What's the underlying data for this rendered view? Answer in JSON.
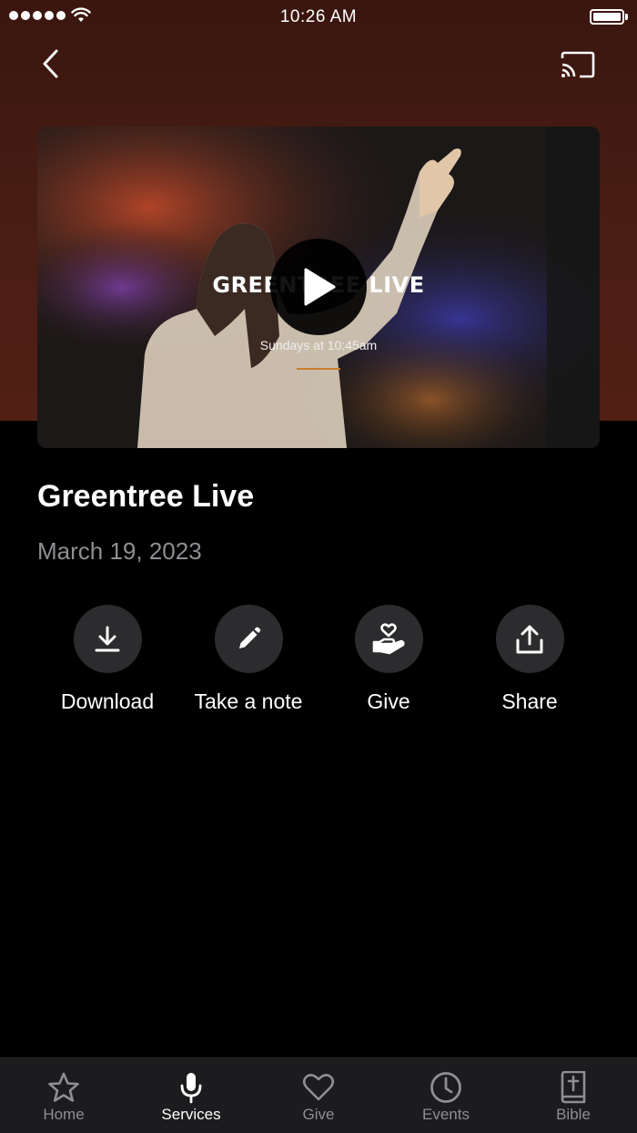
{
  "status_bar": {
    "time": "10:26 AM"
  },
  "video": {
    "title": "GREENTREE LIVE",
    "subtitle": "Sundays at 10:45am"
  },
  "sermon": {
    "title": "Greentree Live",
    "date": "March 19, 2023"
  },
  "actions": [
    {
      "label": "Download",
      "icon": "download-icon"
    },
    {
      "label": "Take a note",
      "icon": "pencil-icon"
    },
    {
      "label": "Give",
      "icon": "hand-heart-icon"
    },
    {
      "label": "Share",
      "icon": "share-icon"
    }
  ],
  "tabs": [
    {
      "label": "Home",
      "icon": "star-icon",
      "active": false
    },
    {
      "label": "Services",
      "icon": "microphone-icon",
      "active": true
    },
    {
      "label": "Give",
      "icon": "heart-icon",
      "active": false
    },
    {
      "label": "Events",
      "icon": "clock-icon",
      "active": false
    },
    {
      "label": "Bible",
      "icon": "bible-icon",
      "active": false
    }
  ],
  "colors": {
    "header_bg": "#4a1e14",
    "accent_underline": "#c97d2e",
    "inactive_tab": "#8e8e93",
    "button_circle": "#2c2c2e"
  }
}
